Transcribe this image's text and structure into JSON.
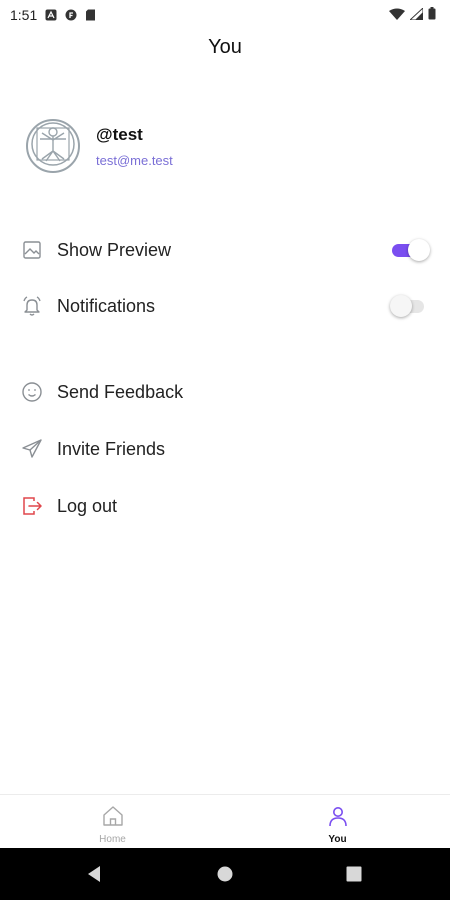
{
  "status_bar": {
    "time": "1:51",
    "icons": [
      "a-icon",
      "f-icon",
      "sd-card-icon",
      "wifi-icon",
      "signal-icon",
      "battery-icon"
    ]
  },
  "header": {
    "title": "You"
  },
  "profile": {
    "username": "@test",
    "email": "test@me.test",
    "avatar_icon": "vitruvian-man-icon"
  },
  "settings": [
    {
      "label": "Show Preview",
      "icon": "image-icon",
      "toggle": true
    },
    {
      "label": "Notifications",
      "icon": "bell-icon",
      "toggle": false
    }
  ],
  "actions": [
    {
      "label": "Send Feedback",
      "icon": "smiley-icon"
    },
    {
      "label": "Invite Friends",
      "icon": "paper-plane-icon"
    },
    {
      "label": "Log out",
      "icon": "logout-icon",
      "color": "#e0474c"
    }
  ],
  "bottom_nav": [
    {
      "label": "Home",
      "icon": "home-icon",
      "active": false
    },
    {
      "label": "You",
      "icon": "user-icon",
      "active": true
    }
  ],
  "colors": {
    "accent": "#7a4ef0",
    "email": "#7a6fd6",
    "logout_icon": "#e0474c",
    "inactive": "#a7a7a7"
  }
}
